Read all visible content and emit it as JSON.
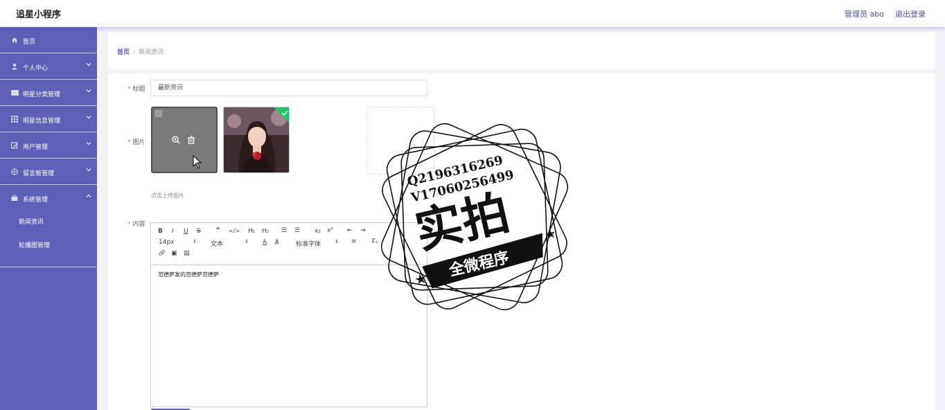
{
  "header": {
    "app_title": "追星小程序",
    "user_label": "管理员 abo",
    "logout_label": "退出登录"
  },
  "sidebar": {
    "items": [
      {
        "label": "首页",
        "icon": "home-icon"
      },
      {
        "label": "个人中心",
        "icon": "user-icon"
      },
      {
        "label": "明星分类管理",
        "icon": "ticket-icon"
      },
      {
        "label": "明星信息管理",
        "icon": "grid-icon"
      },
      {
        "label": "用户管理",
        "icon": "edit-icon"
      },
      {
        "label": "留言板管理",
        "icon": "compass-icon"
      },
      {
        "label": "系统管理",
        "icon": "briefcase-icon"
      }
    ],
    "sub_items": [
      {
        "label": "新闻资讯"
      },
      {
        "label": "轮播图管理"
      }
    ]
  },
  "breadcrumb": {
    "home": "首页",
    "separator": "/",
    "current": "新闻资讯"
  },
  "form": {
    "title_label": "标题",
    "title_value": "最新资讯",
    "image_label": "图片",
    "upload_tip": "点击上传图片",
    "content_label": "内容",
    "editor": {
      "font_size": "14px",
      "text_type": "文本",
      "font_family": "标准字体",
      "content": "范德萨发的范德萨范德萨"
    }
  },
  "watermark": {
    "line1": "Q2196316269",
    "line2": "V17060256499",
    "main": "实拍",
    "banner": "全微程序"
  },
  "colors": {
    "sidebar": "#5d5fb8",
    "accent": "#4a4ea5",
    "required": "#f56c6c"
  }
}
